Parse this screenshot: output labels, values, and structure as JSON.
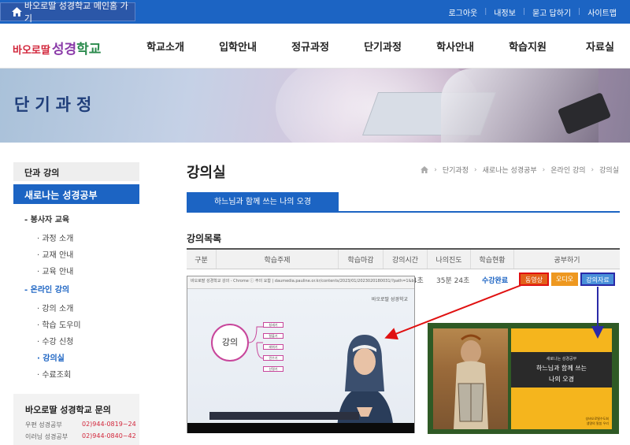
{
  "topbar": {
    "home_link": "바오로딸 성경학교 메인홈 가기",
    "links": [
      "로그아웃",
      "내정보",
      "묻고 답하기",
      "사이트맵"
    ]
  },
  "logo": {
    "part1": "바오로딸",
    "part2": "성경",
    "part3": "학교"
  },
  "nav": [
    "학교소개",
    "입학안내",
    "정규과정",
    "단기과정",
    "학사안내",
    "학습지원",
    "자료실"
  ],
  "banner": {
    "title": "단기과정"
  },
  "sidebar": {
    "head": "단과 강의",
    "active": "새로나는 성경공부",
    "groups": [
      {
        "label": "봉사자 교육",
        "items": [
          "과정 소개",
          "교재 안내",
          "교육 안내"
        ]
      },
      {
        "label": "온라인 강의",
        "items": [
          "강의 소개",
          "학습 도우미",
          "수강 신청",
          "강의실",
          "수료조회"
        ]
      }
    ]
  },
  "contact": {
    "title": "바오로딸 성경학교 문의",
    "rows": [
      {
        "name": "우편 성경공부",
        "phone": "02)944-0819~24"
      },
      {
        "name": "이러닝 성경공부",
        "phone": "02)944-0840~42"
      }
    ]
  },
  "main": {
    "page_title": "강의실",
    "breadcrumb": [
      "단기과정",
      "새로나는 성경공부",
      "온라인 강의",
      "강의실"
    ],
    "course_tab": "하느님과 함께 쓰는 나의 오경",
    "list_title": "강의목록",
    "columns": [
      "구분",
      "학습주제",
      "학습마감",
      "강의시간",
      "나의진도",
      "학습현황",
      "공부하기"
    ],
    "row": {
      "time": "24초",
      "progress": "35분 24초",
      "status": "수강완료",
      "buttons": [
        "동영상",
        "오디오",
        "강의자료"
      ]
    }
  },
  "video": {
    "url_bar": "바오로딸 성경학교 강의 - Chrome   ⓘ 주의 요함 | daumedia.pauline.or.kr/contents/2023/01/2023020180031/?path=1&bookId=...",
    "brand": "바오로딸 성경학교",
    "center": "강의",
    "branches": [
      "창세기",
      "탈출기",
      "레위기",
      "민수기",
      "신명기"
    ]
  },
  "book": {
    "small": "새로나는 성경공부",
    "line1": "하느님과 함께 쓰는",
    "line2": "나의 오경",
    "pub1": "성바오로딸수도회",
    "pub2": "생명의 말씀 우리"
  },
  "colors": {
    "primary": "#1c64c3",
    "video_button": "#e2601a",
    "audio_button": "#ee9820",
    "material_button": "#4a90d9",
    "highlight_red": "#e01010",
    "highlight_navy": "#2a2aa8"
  }
}
